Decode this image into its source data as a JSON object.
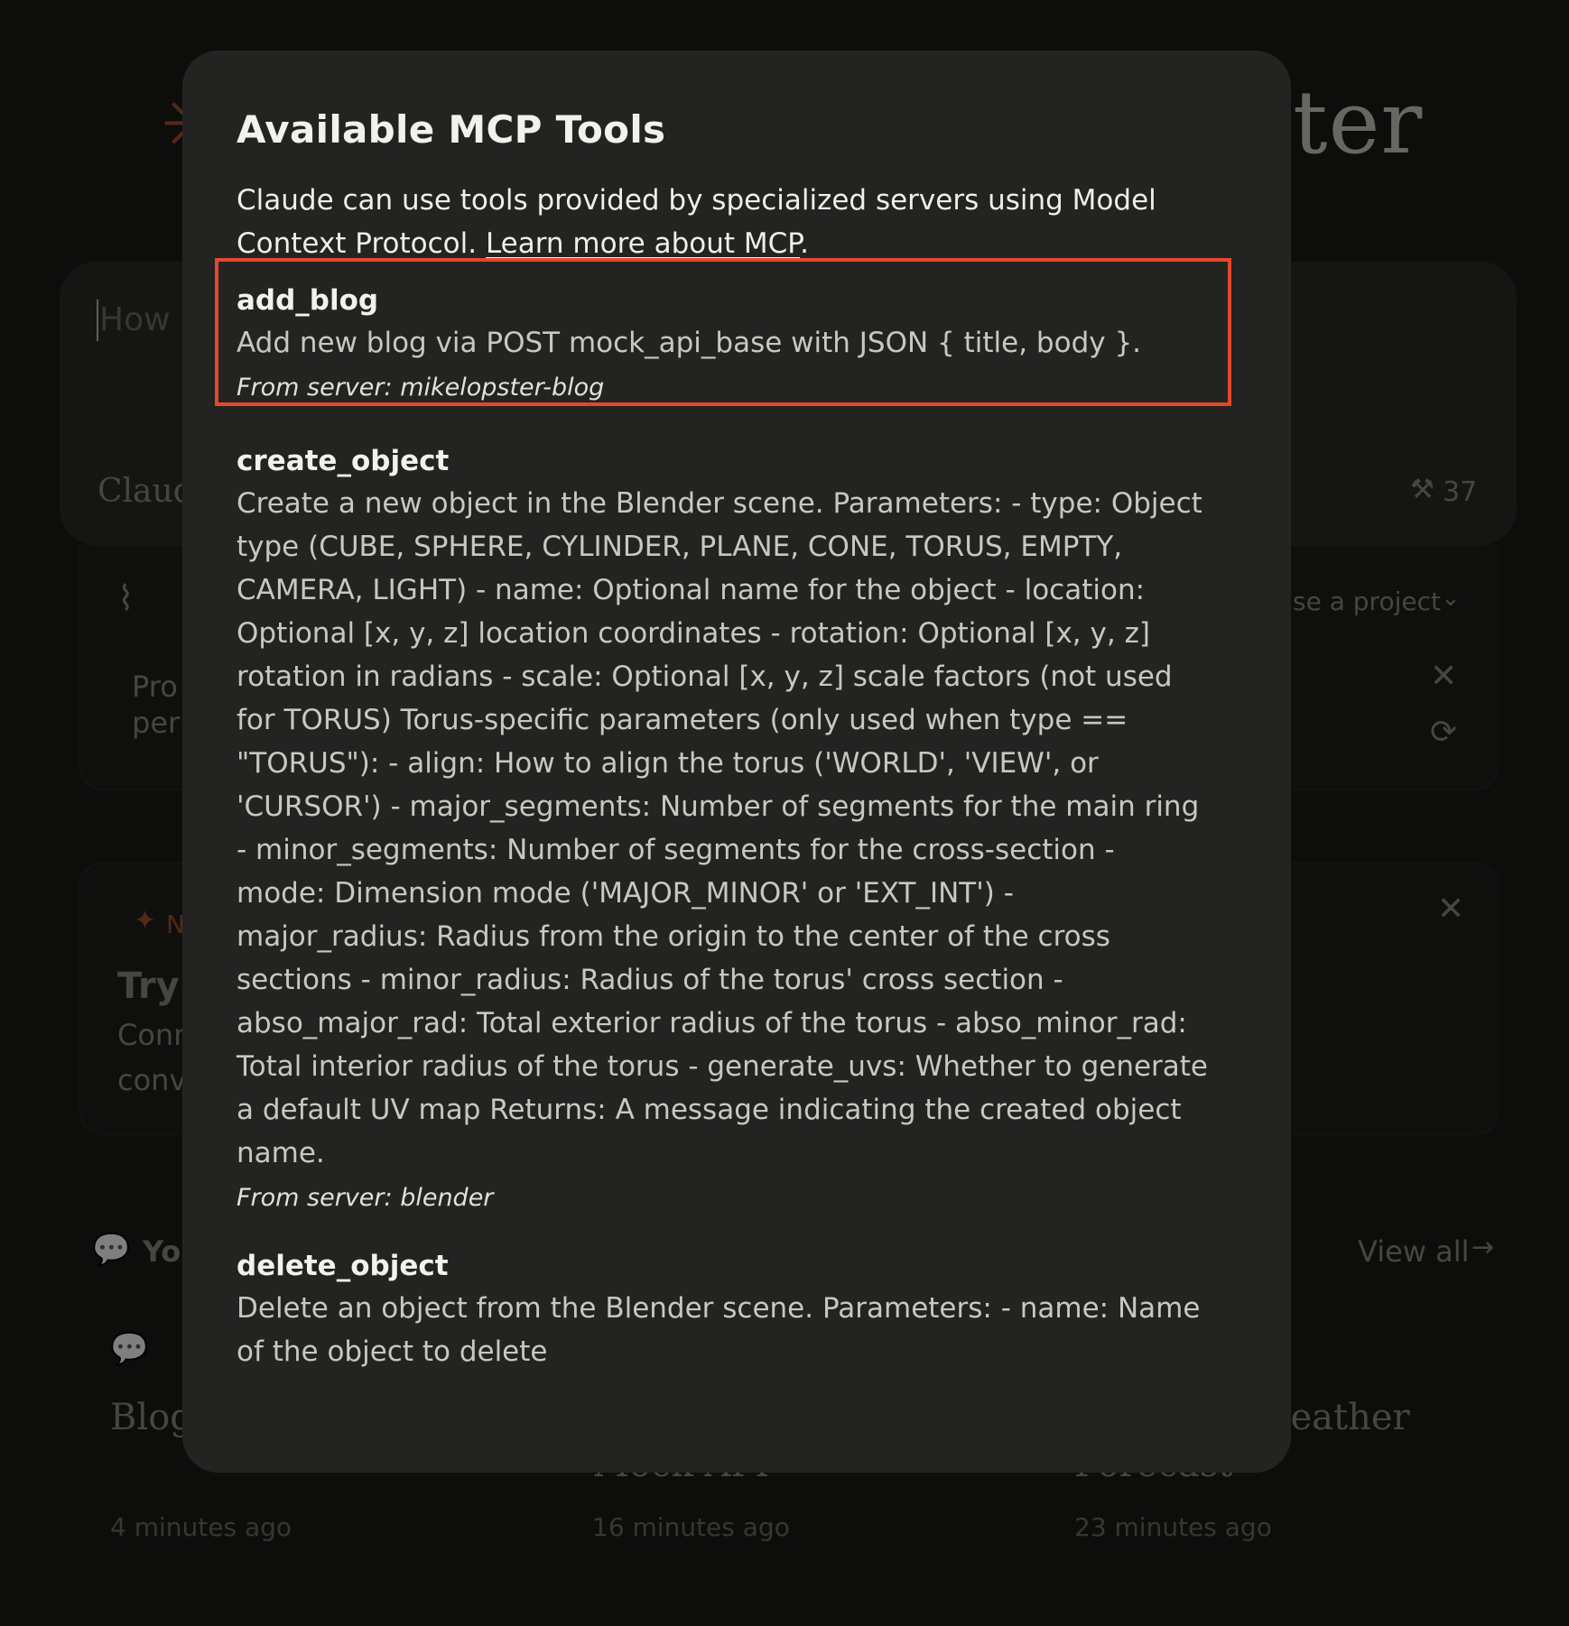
{
  "background": {
    "brand_star": "✳",
    "brand_text": "ter",
    "composer_placeholder": "How c",
    "composer_model": "Claud",
    "tool_count": "37",
    "project_label": "se a project",
    "promo_line1": "Pro",
    "promo_line2": "per",
    "card_badge": "N",
    "card_title": "Try",
    "card_line1": "Conn",
    "card_line2": "conv",
    "recents_title": "Yo",
    "view_all": "View all",
    "recent_items": [
      {
        "title": "Blog",
        "subtitle": "",
        "time": "4 minutes ago"
      },
      {
        "title": "",
        "subtitle": "Mock API",
        "time": "16 minutes ago"
      },
      {
        "title": "/eather",
        "subtitle": "Forecast",
        "time": "23 minutes ago"
      }
    ]
  },
  "modal": {
    "title": "Available MCP Tools",
    "intro": "Claude can use tools provided by specialized servers using Model Context Protocol. ",
    "intro_link": "Learn more about MCP",
    "intro_end": ".",
    "server_prefix": "From server: ",
    "tools": [
      {
        "name": "add_blog",
        "description": "Add new blog via POST mock_api_base with JSON { title, body }.",
        "server": "mikelopster-blog"
      },
      {
        "name": "create_object",
        "description": "Create a new object in the Blender scene. Parameters: - type: Object type (CUBE, SPHERE, CYLINDER, PLANE, CONE, TORUS, EMPTY, CAMERA, LIGHT) - name: Optional name for the object - location: Optional [x, y, z] location coordinates - rotation: Optional [x, y, z] rotation in radians - scale: Optional [x, y, z] scale factors (not used for TORUS) Torus-specific parameters (only used when type == \"TORUS\"): - align: How to align the torus ('WORLD', 'VIEW', or 'CURSOR') - major_segments: Number of segments for the main ring - minor_segments: Number of segments for the cross-section - mode: Dimension mode ('MAJOR_MINOR' or 'EXT_INT') - major_radius: Radius from the origin to the center of the cross sections - minor_radius: Radius of the torus' cross section - abso_major_rad: Total exterior radius of the torus - abso_minor_rad: Total interior radius of the torus - generate_uvs: Whether to generate a default UV map Returns: A message indicating the created object name.",
        "server": "blender"
      },
      {
        "name": "delete_object",
        "description": "Delete an object from the Blender scene. Parameters: - name: Name of the object to delete",
        "server": ""
      }
    ]
  }
}
